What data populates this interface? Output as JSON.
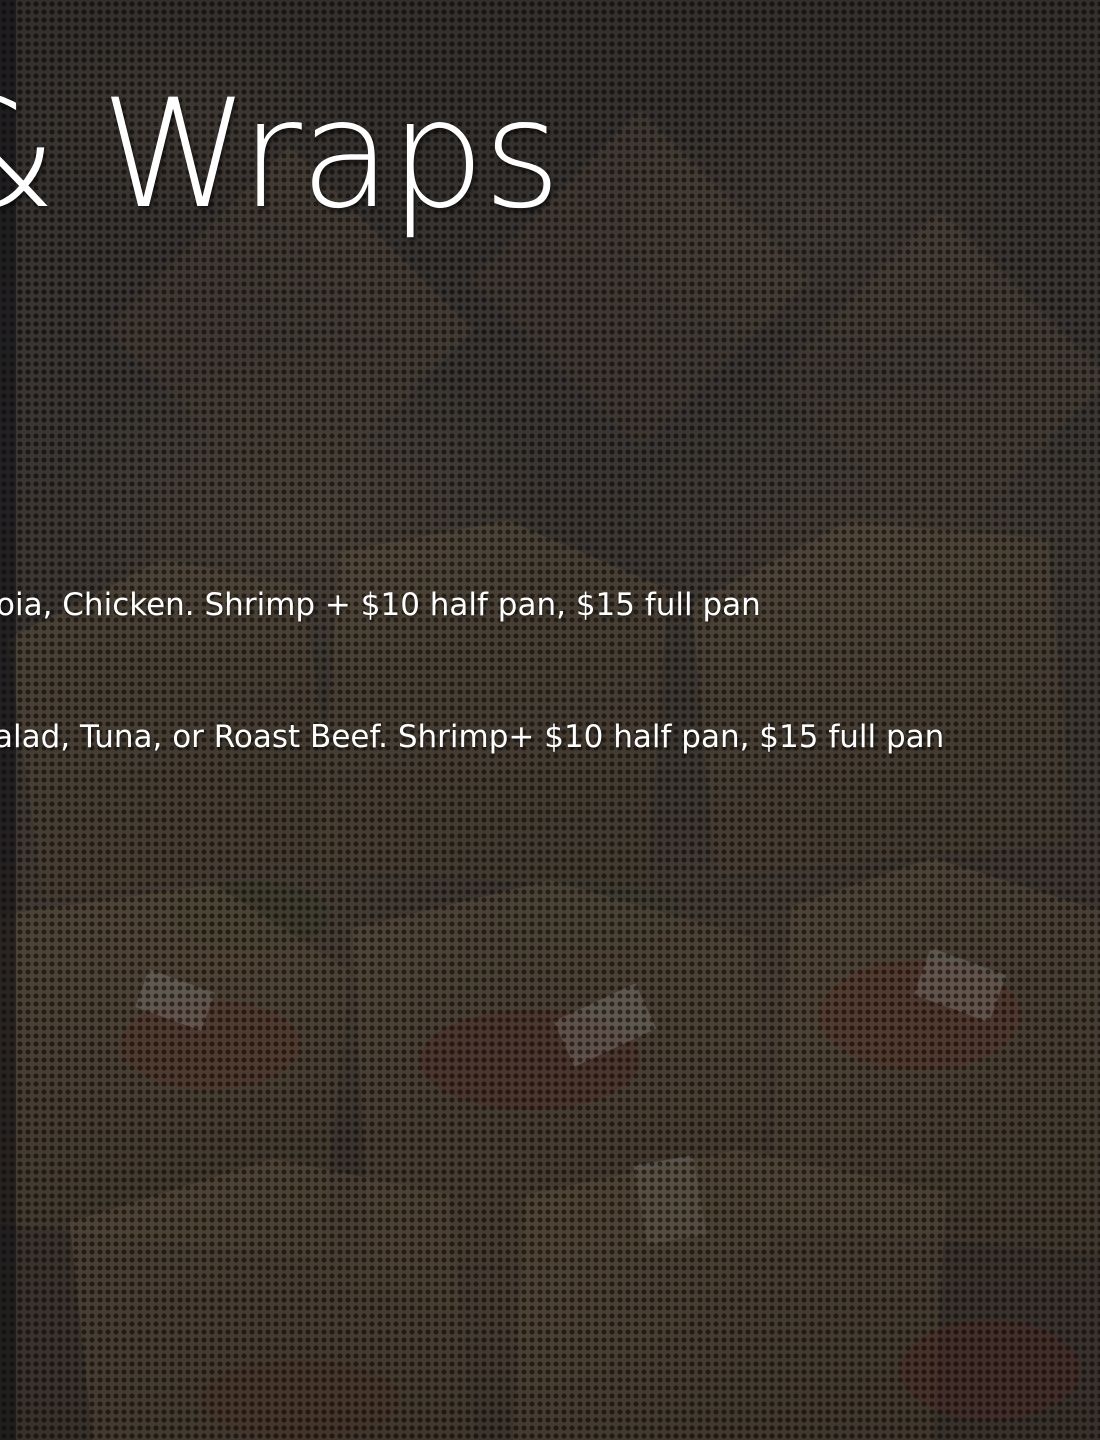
{
  "slide": {
    "title": "& Wraps",
    "lines": [
      "oia, Chicken. Shrimp + $10 half pan, $15 full pan",
      "alad, Tuna, or Roast Beef. Shrimp+ $10 half pan, $15 full pan"
    ]
  },
  "background": {
    "description_icon": "photo-of-boxed-wraps",
    "overlay_color": "#141212"
  }
}
